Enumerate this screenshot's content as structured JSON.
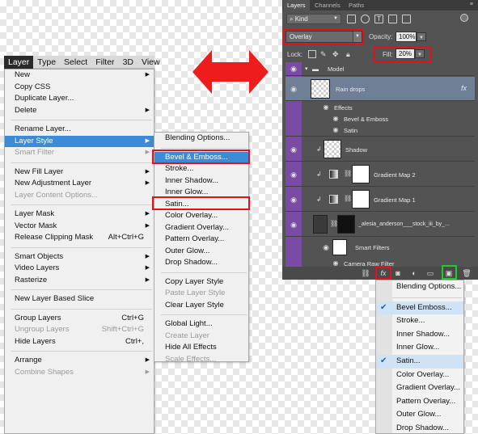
{
  "menubar": {
    "items": [
      "Layer",
      "Type",
      "Select",
      "Filter",
      "3D",
      "View"
    ]
  },
  "layer_menu": {
    "items": [
      {
        "label": "New",
        "submenu": true
      },
      {
        "label": "Copy CSS"
      },
      {
        "label": "Duplicate Layer..."
      },
      {
        "label": "Delete",
        "submenu": true
      },
      {
        "sep": true
      },
      {
        "label": "Rename Layer..."
      },
      {
        "label": "Layer Style",
        "submenu": true,
        "highlighted": true
      },
      {
        "label": "Smart Filter",
        "submenu": true,
        "disabled": true
      },
      {
        "sep": true
      },
      {
        "label": "New Fill Layer",
        "submenu": true
      },
      {
        "label": "New Adjustment Layer",
        "submenu": true
      },
      {
        "label": "Layer Content Options...",
        "disabled": true
      },
      {
        "sep": true
      },
      {
        "label": "Layer Mask",
        "submenu": true
      },
      {
        "label": "Vector Mask",
        "submenu": true
      },
      {
        "label": "Release Clipping Mask",
        "shortcut": "Alt+Ctrl+G"
      },
      {
        "sep": true
      },
      {
        "label": "Smart Objects",
        "submenu": true
      },
      {
        "label": "Video Layers",
        "submenu": true
      },
      {
        "label": "Rasterize",
        "submenu": true
      },
      {
        "sep": true
      },
      {
        "label": "New Layer Based Slice"
      },
      {
        "sep": true
      },
      {
        "label": "Group Layers",
        "shortcut": "Ctrl+G"
      },
      {
        "label": "Ungroup Layers",
        "shortcut": "Shift+Ctrl+G",
        "disabled": true
      },
      {
        "label": "Hide Layers",
        "shortcut": "Ctrl+,"
      },
      {
        "sep": true
      },
      {
        "label": "Arrange",
        "submenu": true
      },
      {
        "label": "Combine Shapes",
        "submenu": true,
        "disabled": true
      }
    ]
  },
  "style_menu": {
    "items": [
      {
        "label": "Blending Options..."
      },
      {
        "sep": true
      },
      {
        "label": "Bevel & Emboss...",
        "highlighted": true
      },
      {
        "label": "Stroke..."
      },
      {
        "label": "Inner Shadow..."
      },
      {
        "label": "Inner Glow..."
      },
      {
        "label": "Satin..."
      },
      {
        "label": "Color Overlay..."
      },
      {
        "label": "Gradient Overlay..."
      },
      {
        "label": "Pattern Overlay..."
      },
      {
        "label": "Outer Glow..."
      },
      {
        "label": "Drop Shadow..."
      },
      {
        "sep": true
      },
      {
        "label": "Copy Layer Style"
      },
      {
        "label": "Paste Layer Style",
        "disabled": true
      },
      {
        "label": "Clear Layer Style"
      },
      {
        "sep": true
      },
      {
        "label": "Global Light..."
      },
      {
        "label": "Create Layer",
        "disabled": true
      },
      {
        "label": "Hide All Effects"
      },
      {
        "label": "Scale Effects...",
        "disabled": true
      }
    ]
  },
  "layers_panel": {
    "tabs": [
      "Layers",
      "Channels",
      "Paths"
    ],
    "filter_kind": "Kind",
    "blend_mode": "Overlay",
    "opacity_label": "Opacity:",
    "opacity_value": "100%",
    "lock_label": "Lock:",
    "fill_label": "Fill:",
    "fill_value": "20%",
    "layers": {
      "group": "Model",
      "rain_drops": "Rain drops",
      "effects": "Effects",
      "bevel": "Bevel & Emboss",
      "satin": "Satin",
      "shadow": "Shadow",
      "gradient2": "Gradient Map 2",
      "gradient1": "Gradient Map 1",
      "smart_obj": "_alesia_anderson___stock_iii_by_...",
      "smart_filters": "Smart Filters",
      "camera_raw": "Camera Raw Filter"
    },
    "fx_badge": "fx"
  },
  "fx_menu": {
    "items": [
      {
        "label": "Blending Options..."
      },
      {
        "sep": true
      },
      {
        "label": "Bevel  Emboss...",
        "checked": true
      },
      {
        "label": "Stroke..."
      },
      {
        "label": "Inner Shadow..."
      },
      {
        "label": "Inner Glow..."
      },
      {
        "label": "Satin...",
        "checked": true
      },
      {
        "label": "Color Overlay..."
      },
      {
        "label": "Gradient Overlay..."
      },
      {
        "label": "Pattern Overlay..."
      },
      {
        "label": "Outer Glow..."
      },
      {
        "label": "Drop Shadow..."
      }
    ]
  },
  "colors": {
    "highlight": "#3b8bd6",
    "red_box": "#e0131b",
    "green_box": "#1ecb29",
    "panel_bg": "#535353",
    "visibility_column": "#7a4ba4"
  }
}
